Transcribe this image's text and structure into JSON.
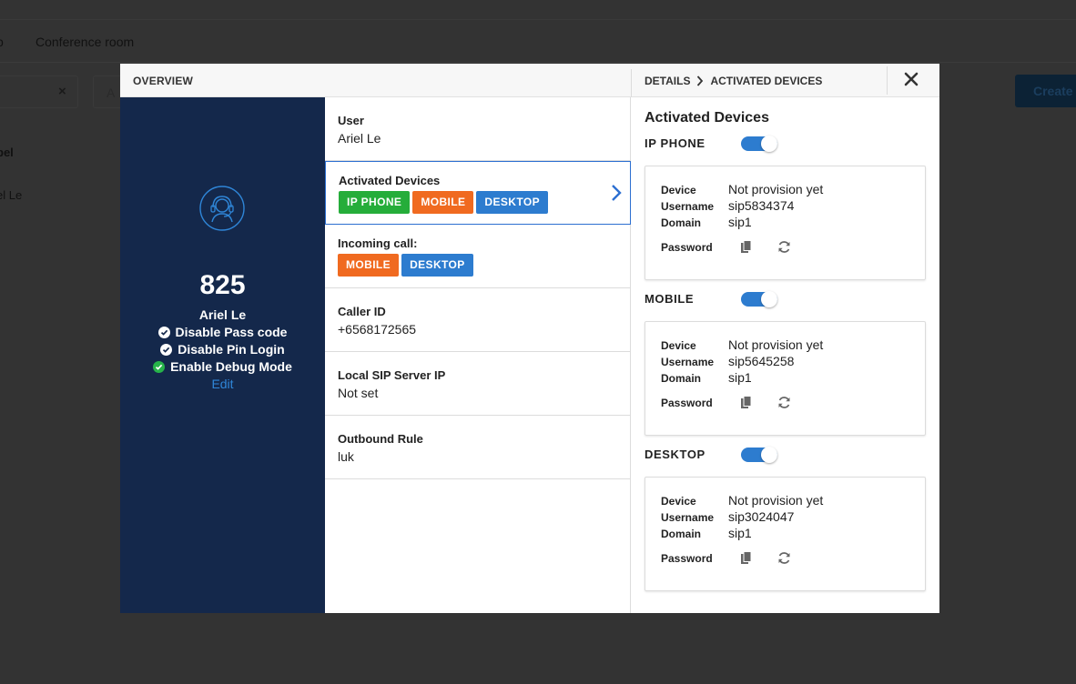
{
  "background": {
    "tabs": [
      "p",
      "Conference room"
    ],
    "search_clear": "×",
    "search2_placeholder": "A",
    "create_label": "Create",
    "column_label": "bel",
    "row_label": "el Le"
  },
  "modal": {
    "overview_title": "OVERVIEW",
    "breadcrumb": {
      "parent": "DETAILS",
      "separator": "›",
      "current": "ACTIVATED DEVICES"
    }
  },
  "profile": {
    "extension": "825",
    "name": "Ariel Le",
    "flags": [
      {
        "label": "Disable Pass code",
        "color": "#ffffff"
      },
      {
        "label": "Disable Pin Login",
        "color": "#ffffff"
      },
      {
        "label": "Enable Debug Mode",
        "color": "#27b34a"
      }
    ],
    "edit_label": "Edit"
  },
  "overview": {
    "user": {
      "label": "User",
      "value": "Ariel Le"
    },
    "activated_devices": {
      "label": "Activated Devices",
      "badges": [
        {
          "text": "IP PHONE",
          "color": "#25ad3a"
        },
        {
          "text": "MOBILE",
          "color": "#f06a20"
        },
        {
          "text": "DESKTOP",
          "color": "#2d7ccf"
        }
      ]
    },
    "incoming_call": {
      "label": "Incoming call:",
      "badges": [
        {
          "text": "MOBILE",
          "color": "#f06a20"
        },
        {
          "text": "DESKTOP",
          "color": "#2d7ccf"
        }
      ]
    },
    "caller_id": {
      "label": "Caller ID",
      "value": "+6568172565"
    },
    "local_sip": {
      "label": "Local SIP Server IP",
      "value": "Not set"
    },
    "outbound_rule": {
      "label": "Outbound Rule",
      "value": "luk"
    }
  },
  "details": {
    "title": "Activated Devices",
    "field_labels": {
      "device": "Device",
      "username": "Username",
      "domain": "Domain",
      "password": "Password"
    },
    "devices": [
      {
        "name": "IP PHONE",
        "enabled": true,
        "device": "Not provision yet",
        "username": "sip5834374",
        "domain": "sip1"
      },
      {
        "name": "MOBILE",
        "enabled": true,
        "device": "Not provision yet",
        "username": "sip5645258",
        "domain": "sip1"
      },
      {
        "name": "DESKTOP",
        "enabled": true,
        "device": "Not provision yet",
        "username": "sip3024047",
        "domain": "sip1"
      }
    ]
  }
}
